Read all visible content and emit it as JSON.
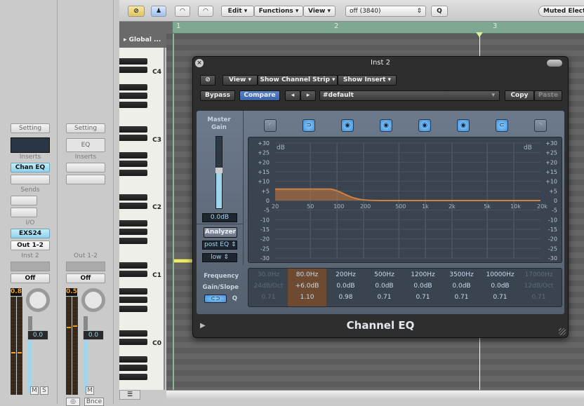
{
  "toolbar": {
    "menus": [
      "Edit",
      "Functions",
      "View"
    ],
    "quantize_value": "off (3840)",
    "q_button": "Q",
    "instrument_label": "Muted Electr",
    "icons": [
      "link-icon",
      "catch-icon",
      "midi-in-icon",
      "midi-out-icon"
    ]
  },
  "ruler": {
    "bars": [
      "1",
      "2",
      "3"
    ]
  },
  "global_tracks": "Global ...",
  "piano": {
    "octave_labels": [
      "C4",
      "C3",
      "C2",
      "C1",
      "C0"
    ]
  },
  "channel_strips": [
    {
      "setting": "Setting",
      "inserts_label": "Inserts",
      "insert_slot": "Chan EQ",
      "sends_label": "Sends",
      "io_label": "I/O",
      "input": "EXS24",
      "output": "Out 1-2",
      "name": "Inst 2",
      "automation": "Off",
      "peak": "0.8",
      "volume": "0.0",
      "buttons": [
        "M",
        "S"
      ]
    },
    {
      "setting": "Setting",
      "eq_label": "EQ",
      "inserts_label": "Inserts",
      "name": "Out 1-2",
      "automation": "Off",
      "peak": "0.5",
      "volume": "0.0",
      "buttons": [
        "M"
      ],
      "bounce": "Bnce"
    }
  ],
  "plugin": {
    "title": "Inst 2",
    "view_menus": [
      "View",
      "Show Channel Strip",
      "Show Insert"
    ],
    "bypass": "Bypass",
    "compare": "Compare",
    "preset": "#default",
    "copy": "Copy",
    "paste": "Paste",
    "name": "Channel EQ",
    "master_gain_label": "Master Gain",
    "master_gain_value": "0.0dB",
    "analyzer": "Analyzer",
    "analyzer_mode": "post EQ",
    "analyzer_res": "low",
    "db_label": "dB",
    "y_ticks": [
      "+30",
      "+25",
      "+20",
      "+15",
      "+10",
      "+5",
      "0",
      "-5",
      "-10",
      "-15",
      "-20",
      "-25",
      "-30"
    ],
    "x_ticks": [
      "20",
      "50",
      "100",
      "200",
      "500",
      "1k",
      "2k",
      "5k",
      "10k",
      "20k"
    ],
    "param_labels": [
      "Frequency",
      "Gain/Slope",
      "Q"
    ],
    "bands": [
      {
        "freq": "30.0Hz",
        "gain": "24dB/Oct",
        "q": "0.71",
        "enabled": false
      },
      {
        "freq": "80.0Hz",
        "gain": "+6.0dB",
        "q": "1.10",
        "enabled": true,
        "selected": true
      },
      {
        "freq": "200Hz",
        "gain": "0.0dB",
        "q": "0.98",
        "enabled": true
      },
      {
        "freq": "500Hz",
        "gain": "0.0dB",
        "q": "0.71",
        "enabled": true
      },
      {
        "freq": "1200Hz",
        "gain": "0.0dB",
        "q": "0.71",
        "enabled": true
      },
      {
        "freq": "3500Hz",
        "gain": "0.0dB",
        "q": "0.71",
        "enabled": true
      },
      {
        "freq": "10000Hz",
        "gain": "0.0dB",
        "q": "0.71",
        "enabled": true
      },
      {
        "freq": "17000Hz",
        "gain": "12dB/Oct",
        "q": "0.71",
        "enabled": false
      }
    ],
    "curve_color": "#d08040"
  }
}
